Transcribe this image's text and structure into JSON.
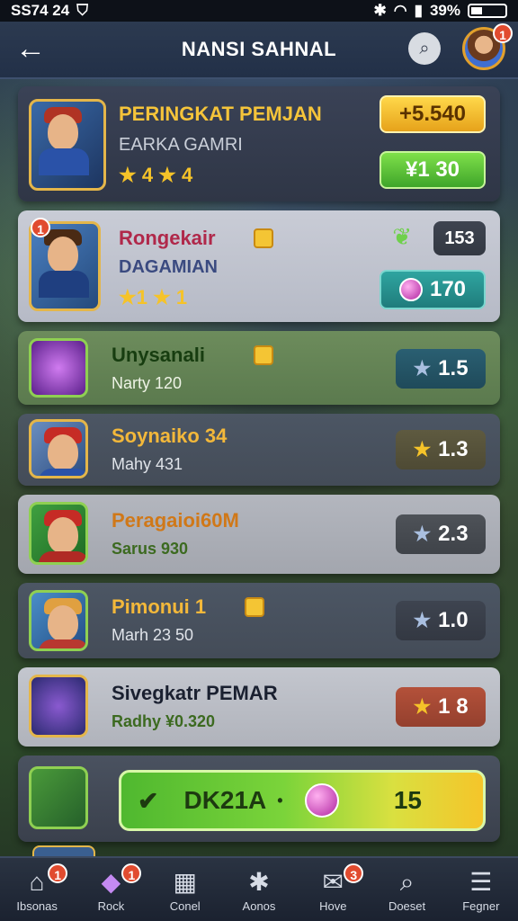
{
  "status_bar": {
    "left_text": "SS74 24",
    "battery": "39%"
  },
  "header": {
    "title": "NANSI SAHNAL",
    "back_icon": "arrow-left-icon",
    "search_icon": "search-icon",
    "avatar_badge": "1"
  },
  "cards": [
    {
      "title": "PERINGKAT PEMJAN",
      "subtitle": "EARKA GAMRI",
      "stars": "★ 4 ★ 4",
      "pill_top": "+5.540",
      "pill_bottom": "¥1 30"
    },
    {
      "title": "Rongekair",
      "subtitle": "DAGAMIAN",
      "stars": "★1 ★ 1",
      "badge": "1",
      "pill_top": "153",
      "pill_bottom": "170"
    },
    {
      "title": "Unysanali",
      "subtitle": "Narty 120",
      "pill": "1.5"
    },
    {
      "title": "Soynaiko 34",
      "subtitle": "Mahy 431",
      "pill": "1.3"
    },
    {
      "title": "Peragaioi60M",
      "subtitle": "Sarus 930",
      "pill": "2.3"
    },
    {
      "title": "Pimonui 1",
      "subtitle": "Marh 23 50",
      "pill": "1.0"
    },
    {
      "title": "Sivegkatr PEMAR",
      "subtitle": "Radhy ¥0.320",
      "pill": "1 8"
    }
  ],
  "claim_bar": {
    "label": "DK21A",
    "value": "15"
  },
  "nav": [
    {
      "label": "Ibsonas",
      "icon": "home-icon",
      "badge": "1"
    },
    {
      "label": "Rock",
      "icon": "gem-icon",
      "badge": "1"
    },
    {
      "label": "Conel",
      "icon": "card-icon",
      "badge": ""
    },
    {
      "label": "Aonos",
      "icon": "asterisk-icon",
      "badge": ""
    },
    {
      "label": "Hove",
      "icon": "mail-icon",
      "badge": "3"
    },
    {
      "label": "Doeset",
      "icon": "search-icon",
      "badge": ""
    },
    {
      "label": "Fegner",
      "icon": "menu-icon",
      "badge": ""
    }
  ]
}
